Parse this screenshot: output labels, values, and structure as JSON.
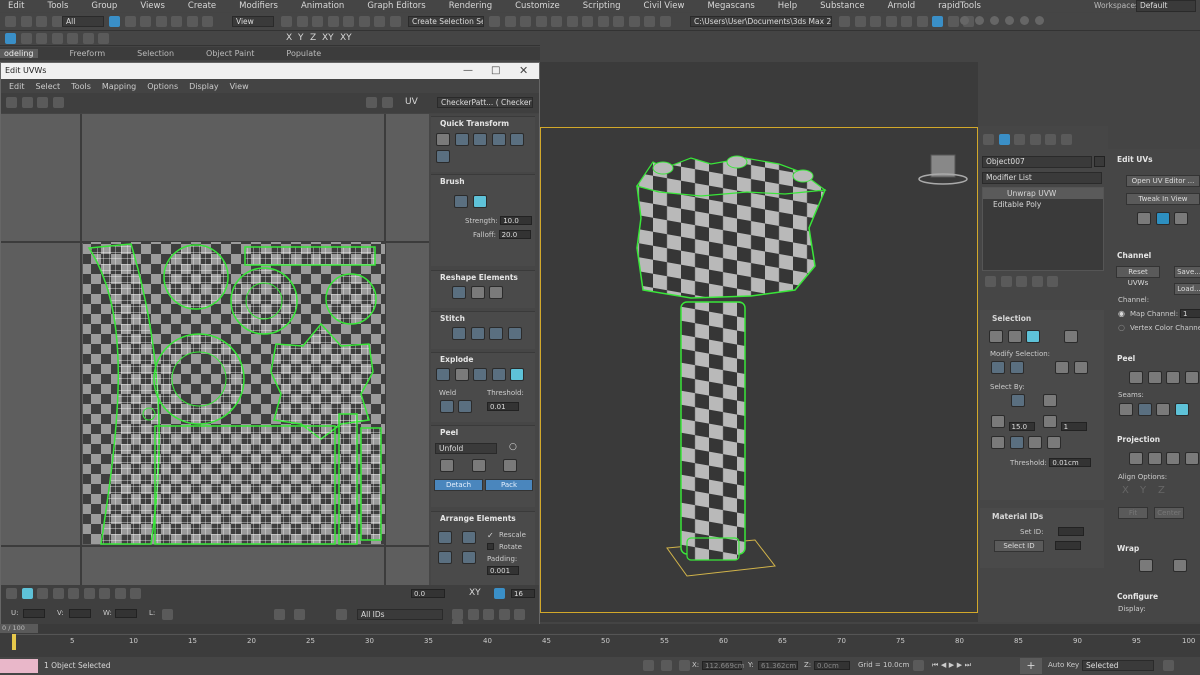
{
  "menubar": [
    "Edit",
    "Tools",
    "Group",
    "Views",
    "Create",
    "Modifiers",
    "Animation",
    "Graph Editors",
    "Rendering",
    "Customize",
    "Scripting",
    "Civil View",
    "Megascans",
    "Help",
    "Substance",
    "Arnold",
    "rapidTools"
  ],
  "workspaces_label": "Workspaces:",
  "workspaces_value": "Default",
  "toolbar": {
    "filter_all": "All",
    "view_dropdown": "View",
    "selection_set": "Create Selection Se",
    "project_path": "C:\\Users\\User\\Documents\\3ds Max 2023",
    "axis_x": "X",
    "axis_y": "Y",
    "axis_z": "Z",
    "axis_xy": "XY",
    "axis_xy2": "XY"
  },
  "ribbon": [
    "odeling",
    "Freeform",
    "Selection",
    "Object Paint",
    "Populate"
  ],
  "uv_editor": {
    "title": "Edit UVWs",
    "menu": [
      "Edit",
      "Select",
      "Tools",
      "Mapping",
      "Options",
      "Display",
      "View"
    ],
    "uv_label": "UV",
    "checker_dropdown": "CheckerPatt... ( Checker )",
    "sections": {
      "quick_transform": "Quick Transform",
      "brush": "Brush",
      "strength_label": "Strength:",
      "strength_value": "10.0",
      "falloff_label": "Falloff:",
      "falloff_value": "20.0",
      "reshape": "Reshape Elements",
      "stitch": "Stitch",
      "explode": "Explode",
      "weld_label": "Weld",
      "threshold_label": "Threshold:",
      "threshold_value": "0.01",
      "peel": "Peel",
      "unfold_dropdown": "Unfold",
      "detach_button": "Detach",
      "pack_button": "Pack",
      "arrange": "Arrange Elements",
      "rescale_label": "Rescale",
      "rotate_label": "Rotate",
      "padding_label": "Padding:",
      "padding_value": "0.001"
    },
    "bottom": {
      "u_label": "U:",
      "v_label": "V:",
      "w_label": "W:",
      "l_label": "L:",
      "spin_value": "0.0",
      "xy_label": "XY",
      "grid_value": "16",
      "ids_dropdown": "All IDs"
    }
  },
  "command_panel": {
    "object_name": "Object007",
    "modifier_list": "Modifier List",
    "stack": [
      "Unwrap UVW",
      "Editable Poly"
    ],
    "selection_title": "Selection",
    "modify_selection": "Modify Selection:",
    "select_by": "Select By:",
    "angle_value": "15.0",
    "count_value": "1",
    "threshold_label": "Threshold:",
    "threshold_value": "0.01cm",
    "material_ids_title": "Material IDs",
    "set_id_label": "Set ID:",
    "select_id_button": "Select ID"
  },
  "right_panel": {
    "edit_uvs_title": "Edit UVs",
    "open_uv_editor": "Open UV Editor ...",
    "tweak_in_view": "Tweak In View",
    "channel_title": "Channel",
    "reset_uvws": "Reset UVWs",
    "save_button": "Save...",
    "load_button": "Load...",
    "channel_label": "Channel:",
    "map_channel_label": "Map Channel:",
    "map_channel_value": "1",
    "vertex_color_channel": "Vertex Color Channel",
    "peel_title": "Peel",
    "seams_label": "Seams:",
    "projection_title": "Projection",
    "align_options": "Align Options:",
    "axis_x": "X",
    "axis_y": "Y",
    "axis_z": "Z",
    "fit_button": "Fit",
    "center_button": "Center",
    "wrap_title": "Wrap",
    "configure_title": "Configure",
    "display_label": "Display:"
  },
  "timeline": {
    "ticks": [
      "5",
      "10",
      "15",
      "20",
      "25",
      "30",
      "35",
      "40",
      "45",
      "50",
      "55",
      "60",
      "65",
      "70",
      "75",
      "80",
      "85",
      "90",
      "95",
      "100"
    ],
    "frame_label": "0 / 100"
  },
  "status_bar": {
    "selected_text": "1 Object Selected",
    "x_label": "X:",
    "x_value": "112.669cm",
    "y_label": "Y:",
    "y_value": "61.362cm",
    "z_label": "Z:",
    "z_value": "0.0cm",
    "grid_text": "Grid = 10.0cm",
    "auto_key": "Auto Key",
    "selected_dropdown": "Selected"
  },
  "colors": {
    "accent_blue": "#2d8fc0",
    "selection_green": "#39e639",
    "viewport_frame": "#d2a82a"
  }
}
